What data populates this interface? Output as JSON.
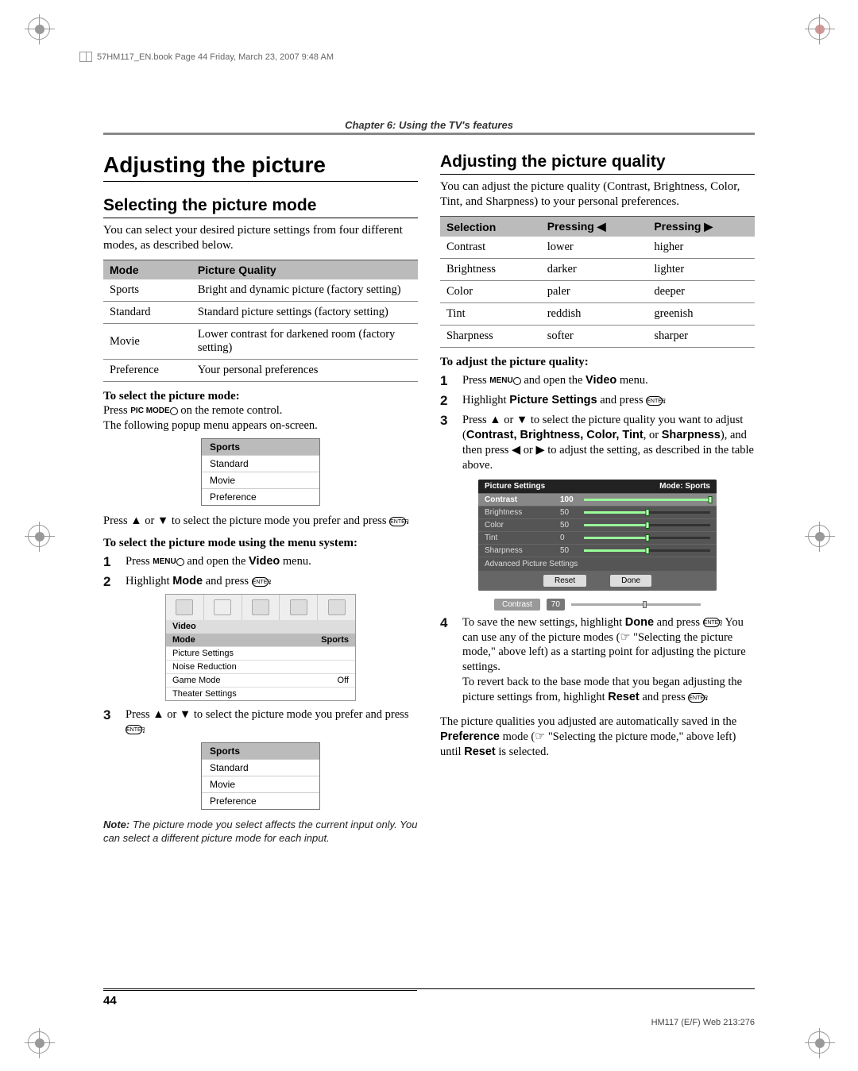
{
  "print_header": "57HM117_EN.book  Page 44  Friday, March 23, 2007  9:48 AM",
  "chapter": "Chapter 6: Using the TV's features",
  "left": {
    "title": "Adjusting the picture",
    "sub": "Selecting the picture mode",
    "intro": "You can select your desired picture settings from four different modes, as described below.",
    "table_headers": {
      "mode": "Mode",
      "quality": "Picture Quality"
    },
    "table": [
      {
        "mode": "Sports",
        "quality": "Bright and dynamic picture (factory setting)"
      },
      {
        "mode": "Standard",
        "quality": "Standard picture settings (factory setting)"
      },
      {
        "mode": "Movie",
        "quality": "Lower contrast for darkened room (factory setting)"
      },
      {
        "mode": "Preference",
        "quality": "Your personal preferences"
      }
    ],
    "to_select_hdr": "To select the picture mode:",
    "press_picmode_a": "Press ",
    "press_picmode_b": " on the remote control.",
    "picmode_label": "PIC MODE",
    "popup_appears": "The following popup menu appears on-screen.",
    "popup_items": [
      "Sports",
      "Standard",
      "Movie",
      "Preference"
    ],
    "press_updown": "Press ▲ or ▼ to select the picture mode you prefer and press ",
    "enter_label": "ENTER",
    "to_select_menu_hdr": "To select the picture mode using the menu system:",
    "step1_a": "Press ",
    "menu_label": "MENU",
    "step1_b": " and open the ",
    "step1_video": "Video",
    "step1_c": " menu.",
    "step2_a": "Highlight ",
    "step2_mode": "Mode",
    "step2_b": " and press ",
    "video_menu": {
      "title": "Video",
      "rows": [
        {
          "l": "Mode",
          "r": "Sports",
          "hdr": true
        },
        {
          "l": "Picture Settings",
          "r": ""
        },
        {
          "l": "Noise Reduction",
          "r": ""
        },
        {
          "l": "Game Mode",
          "r": "Off"
        },
        {
          "l": "Theater Settings",
          "r": ""
        }
      ]
    },
    "step3": "Press ▲ or ▼ to select the picture mode you prefer and press ",
    "note": "Note:",
    "note_body": " The picture mode you select affects the current input only. You can select a different picture mode for each input."
  },
  "right": {
    "sub": "Adjusting the picture quality",
    "intro": "You can adjust the picture quality (Contrast, Brightness, Color, Tint, and Sharpness) to your personal preferences.",
    "table_headers": {
      "sel": "Selection",
      "left": "Pressing ◀",
      "right": "Pressing ▶"
    },
    "table": [
      {
        "s": "Contrast",
        "l": "lower",
        "r": "higher"
      },
      {
        "s": "Brightness",
        "l": "darker",
        "r": "lighter"
      },
      {
        "s": "Color",
        "l": "paler",
        "r": "deeper"
      },
      {
        "s": "Tint",
        "l": "reddish",
        "r": "greenish"
      },
      {
        "s": "Sharpness",
        "l": "softer",
        "r": "sharper"
      }
    ],
    "to_adjust_hdr": "To adjust the picture quality:",
    "step1_a": "Press ",
    "step1_b": " and open the ",
    "step1_video": "Video",
    "step1_c": " menu.",
    "step2_a": "Highlight ",
    "step2_ps": "Picture Settings",
    "step2_b": " and press ",
    "step3_a": "Press ▲ or ▼ to select the picture quality you want to adjust (",
    "step3_list": "Contrast, Brightness, Color, Tint",
    "step3_or": ", or ",
    "step3_sharp": "Sharpness",
    "step3_b": "), and then press ◀ or ▶ to adjust the setting, as described in the table above.",
    "ps_panel": {
      "title_l": "Picture Settings",
      "title_r": "Mode: Sports",
      "rows": [
        {
          "l": "Contrast",
          "v": "100",
          "p": 100,
          "sel": true
        },
        {
          "l": "Brightness",
          "v": "50",
          "p": 50
        },
        {
          "l": "Color",
          "v": "50",
          "p": 50
        },
        {
          "l": "Tint",
          "v": "0",
          "p": 50
        },
        {
          "l": "Sharpness",
          "v": "50",
          "p": 50
        }
      ],
      "adv": "Advanced Picture Settings",
      "reset": "Reset",
      "done": "Done"
    },
    "slider": {
      "lbl": "Contrast",
      "val": "70"
    },
    "step4_a": "To save the new settings, highlight ",
    "step4_done": "Done",
    "step4_b": " and press ",
    "step4_c": ". You can use any of the picture modes (☞ \"Selecting the picture mode,\" above left) as a starting point for adjusting the picture settings.",
    "step4_d": "To revert back to the base mode that you began adjusting the picture settings from, highlight ",
    "step4_reset": "Reset",
    "step4_e": " and press ",
    "tail_a": "The picture qualities you adjusted are automatically saved in the ",
    "tail_pref": "Preference",
    "tail_b": " mode (☞ \"Selecting the picture mode,\" above left) until ",
    "tail_reset": "Reset",
    "tail_c": " is selected."
  },
  "page_num": "44",
  "footer_right": "HM117 (E/F) Web 213:276"
}
